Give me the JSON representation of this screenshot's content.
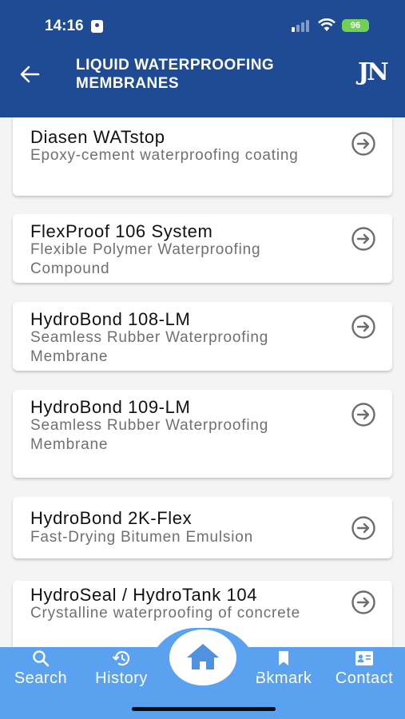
{
  "status_bar": {
    "time": "14:16",
    "battery": "96"
  },
  "header": {
    "title": "LIQUID WATERPROOFING MEMBRANES",
    "logo": "JN"
  },
  "products": [
    {
      "name": "Diasen WATstop",
      "description": "Epoxy-cement waterproofing coating"
    },
    {
      "name": "FlexProof 106 System",
      "description": "Flexible Polymer Waterproofing Compound"
    },
    {
      "name": "HydroBond 108-LM",
      "description": "Seamless Rubber Waterproofing Membrane"
    },
    {
      "name": "HydroBond 109-LM",
      "description": "Seamless Rubber Waterproofing Membrane"
    },
    {
      "name": "HydroBond 2K-Flex",
      "description": "Fast-Drying Bitumen Emulsion"
    },
    {
      "name": "HydroSeal / HydroTank 104",
      "description": "Crystalline waterproofing of concrete"
    }
  ],
  "bottom_nav": {
    "search": "Search",
    "history": "History",
    "bookmark": "Bkmark",
    "contact": "Contact"
  },
  "colors": {
    "header": "#1f4a94",
    "nav": "#5aa2ef",
    "battery": "#6fd254"
  }
}
